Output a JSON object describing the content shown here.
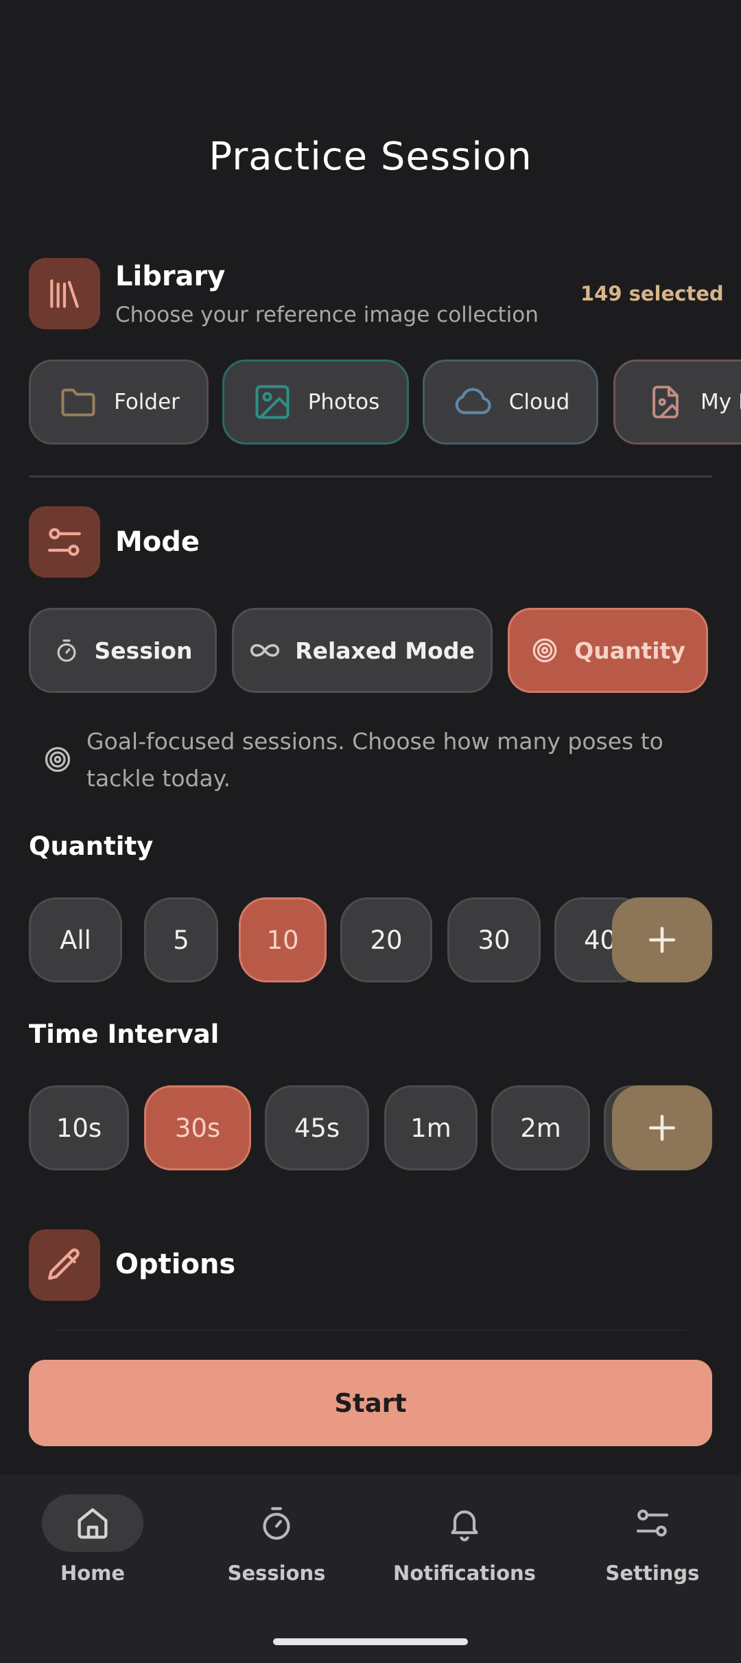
{
  "header": {
    "title": "Practice Session"
  },
  "library": {
    "icon": "library-books-icon",
    "title": "Library",
    "subtitle": "Choose your reference image collection",
    "count": "149 selected",
    "sources": [
      {
        "label": "Folder",
        "icon": "folder-icon",
        "color": "#9a7f5e"
      },
      {
        "label": "Photos",
        "icon": "image-icon",
        "color": "#2f8f87"
      },
      {
        "label": "Cloud",
        "icon": "cloud-icon",
        "color": "#5e87a8"
      },
      {
        "label": "My L",
        "icon": "file-image-icon",
        "color": "#c08e84"
      }
    ]
  },
  "mode": {
    "icon": "sliders-icon",
    "title": "Mode",
    "options": [
      {
        "label": "Session",
        "icon": "stopwatch-icon",
        "active": false
      },
      {
        "label": "Relaxed Mode",
        "icon": "infinity-icon",
        "active": false
      },
      {
        "label": "Quantity",
        "icon": "target-icon",
        "active": true
      }
    ],
    "description": "Goal-focused sessions. Choose how many poses to tackle today."
  },
  "quantity": {
    "label": "Quantity",
    "options": [
      "All",
      "5",
      "10",
      "20",
      "30",
      "40"
    ],
    "selected": "10"
  },
  "interval": {
    "label": "Time Interval",
    "options": [
      "10s",
      "30s",
      "45s",
      "1m",
      "2m"
    ],
    "selected": "30s"
  },
  "options": {
    "icon": "pencil-icon",
    "title": "Options"
  },
  "start": {
    "label": "Start"
  },
  "nav": {
    "items": [
      {
        "label": "Home",
        "icon": "home-icon",
        "active": true
      },
      {
        "label": "Sessions",
        "icon": "stopwatch-icon",
        "active": false
      },
      {
        "label": "Notifications",
        "icon": "bell-icon",
        "active": false
      },
      {
        "label": "Settings",
        "icon": "sliders-icon",
        "active": false
      }
    ]
  },
  "colors": {
    "accent": "#b95a48",
    "start": "#e89a84",
    "add": "#8c7657",
    "section_icon_bg": "#6e3a30",
    "count": "#d9b48a"
  }
}
